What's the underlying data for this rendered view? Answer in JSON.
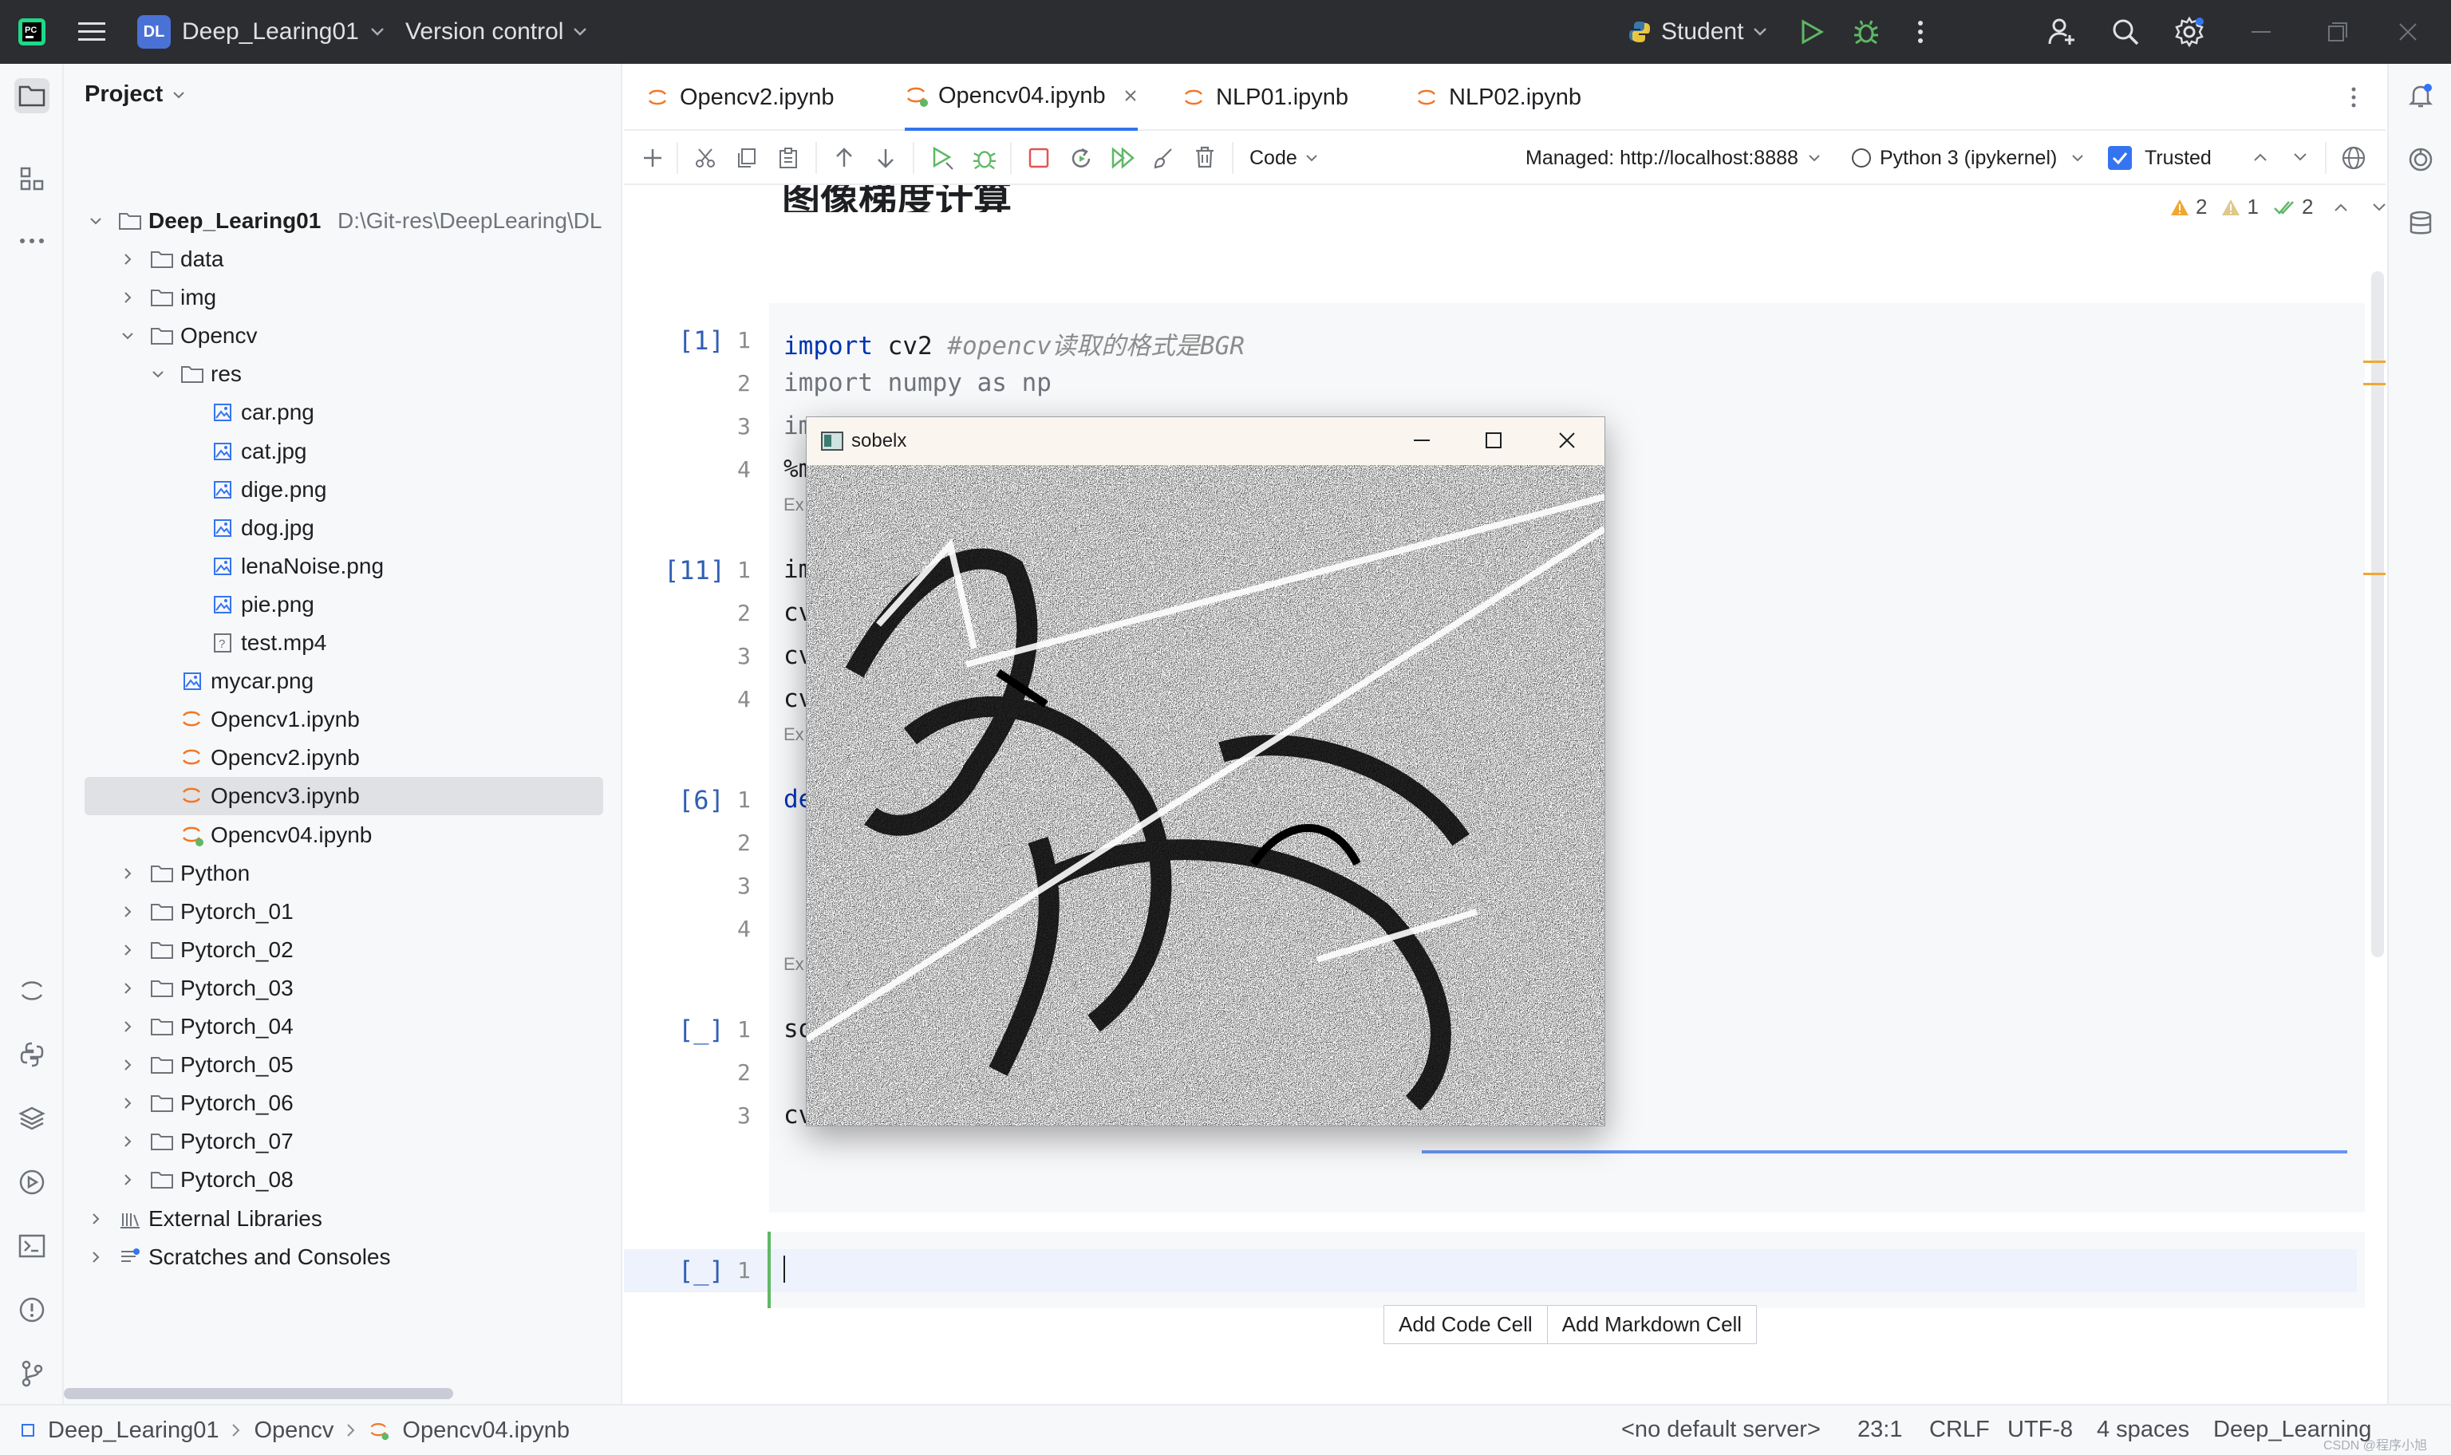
{
  "titlebar": {
    "project_badge": "DL",
    "project_name": "Deep_Learing01",
    "vcs_label": "Version control",
    "run_config": "Student",
    "colors": {
      "bg": "#2b2d30",
      "badge": "#4a72d6",
      "run": "#5fb865"
    }
  },
  "project_panel": {
    "title": "Project",
    "root": {
      "name": "Deep_Learing01",
      "path": "D:\\Git-res\\DeepLearing\\DL"
    },
    "tree": [
      {
        "label": "data",
        "kind": "folder",
        "level": 1,
        "state": "closed"
      },
      {
        "label": "img",
        "kind": "folder",
        "level": 1,
        "state": "closed"
      },
      {
        "label": "Opencv",
        "kind": "folder",
        "level": 1,
        "state": "open"
      },
      {
        "label": "res",
        "kind": "folder",
        "level": 2,
        "state": "open"
      },
      {
        "label": "car.png",
        "kind": "image",
        "level": 3
      },
      {
        "label": "cat.jpg",
        "kind": "image",
        "level": 3
      },
      {
        "label": "dige.png",
        "kind": "image",
        "level": 3
      },
      {
        "label": "dog.jpg",
        "kind": "image",
        "level": 3
      },
      {
        "label": "lenaNoise.png",
        "kind": "image",
        "level": 3
      },
      {
        "label": "pie.png",
        "kind": "image",
        "level": 3
      },
      {
        "label": "test.mp4",
        "kind": "unknown",
        "level": 3
      },
      {
        "label": "mycar.png",
        "kind": "image",
        "level": 2
      },
      {
        "label": "Opencv1.ipynb",
        "kind": "notebook",
        "level": 2
      },
      {
        "label": "Opencv2.ipynb",
        "kind": "notebook",
        "level": 2
      },
      {
        "label": "Opencv3.ipynb",
        "kind": "notebook",
        "level": 2,
        "selected": true
      },
      {
        "label": "Opencv04.ipynb",
        "kind": "notebook-active",
        "level": 2
      },
      {
        "label": "Python",
        "kind": "folder",
        "level": 1,
        "state": "closed"
      },
      {
        "label": "Pytorch_01",
        "kind": "folder",
        "level": 1,
        "state": "closed"
      },
      {
        "label": "Pytorch_02",
        "kind": "folder",
        "level": 1,
        "state": "closed"
      },
      {
        "label": "Pytorch_03",
        "kind": "folder",
        "level": 1,
        "state": "closed"
      },
      {
        "label": "Pytorch_04",
        "kind": "folder",
        "level": 1,
        "state": "closed"
      },
      {
        "label": "Pytorch_05",
        "kind": "folder",
        "level": 1,
        "state": "closed"
      },
      {
        "label": "Pytorch_06",
        "kind": "folder",
        "level": 1,
        "state": "closed"
      },
      {
        "label": "Pytorch_07",
        "kind": "folder",
        "level": 1,
        "state": "closed"
      },
      {
        "label": "Pytorch_08",
        "kind": "folder",
        "level": 1,
        "state": "closed"
      },
      {
        "label": "External Libraries",
        "kind": "libraries",
        "level": 0,
        "state": "closed"
      },
      {
        "label": "Scratches and Consoles",
        "kind": "scratches",
        "level": 0,
        "state": "closed"
      }
    ]
  },
  "tabs": [
    {
      "label": "Opencv2.ipynb",
      "active": false
    },
    {
      "label": "Opencv04.ipynb",
      "active": true
    },
    {
      "label": "NLP01.ipynb",
      "active": false
    },
    {
      "label": "NLP02.ipynb",
      "active": false
    }
  ],
  "notebook_toolbar": {
    "cell_type": "Code",
    "server": "Managed: http://localhost:8888",
    "kernel": "Python 3 (ipykernel)",
    "trusted_label": "Trusted",
    "inspections": {
      "warnings": "2",
      "weak_warnings": "1",
      "ok": "2"
    }
  },
  "heading_partial": "图像梯度计算",
  "cells": [
    {
      "exec": "[1]",
      "lines": [
        {
          "n": "1",
          "text": "cv2 ",
          "kw": "import",
          "comment": "#opencv读取的格式是BGR"
        },
        {
          "n": "2",
          "text": "import numpy as np"
        },
        {
          "n": "3",
          "text": "im"
        },
        {
          "n": "4",
          "text": "%m"
        }
      ],
      "footer": "Ex"
    },
    {
      "exec": "[11]",
      "lines": [
        {
          "n": "1",
          "text": "im"
        },
        {
          "n": "2",
          "text": "cv"
        },
        {
          "n": "3",
          "text": "cv"
        },
        {
          "n": "4",
          "text": "cv"
        }
      ],
      "footer": "Ex"
    },
    {
      "exec": "[6]",
      "lines": [
        {
          "n": "1",
          "text": "de"
        },
        {
          "n": "2",
          "text": ""
        },
        {
          "n": "3",
          "text": ""
        },
        {
          "n": "4",
          "text": ""
        }
      ],
      "footer": "Ex"
    },
    {
      "exec": "[_]",
      "lines": [
        {
          "n": "1",
          "text": "so"
        },
        {
          "n": "2",
          "text": ""
        },
        {
          "n": "3",
          "text": "cv"
        }
      ]
    },
    {
      "exec": "[_]",
      "lines": [
        {
          "n": "1",
          "text": ""
        }
      ],
      "active": true
    }
  ],
  "add_cell": {
    "code": "Add Code Cell",
    "markdown": "Add Markdown Cell"
  },
  "popup": {
    "title": "sobelx"
  },
  "statusbar": {
    "breadcrumbs": [
      "Deep_Learing01",
      "Opencv",
      "Opencv04.ipynb"
    ],
    "server": "<no default server>",
    "position": "23:1",
    "line_sep": "CRLF",
    "encoding": "UTF-8",
    "indent": "4 spaces",
    "interpreter": "Deep_Learning",
    "watermark": "CSDN @程序小旭"
  }
}
